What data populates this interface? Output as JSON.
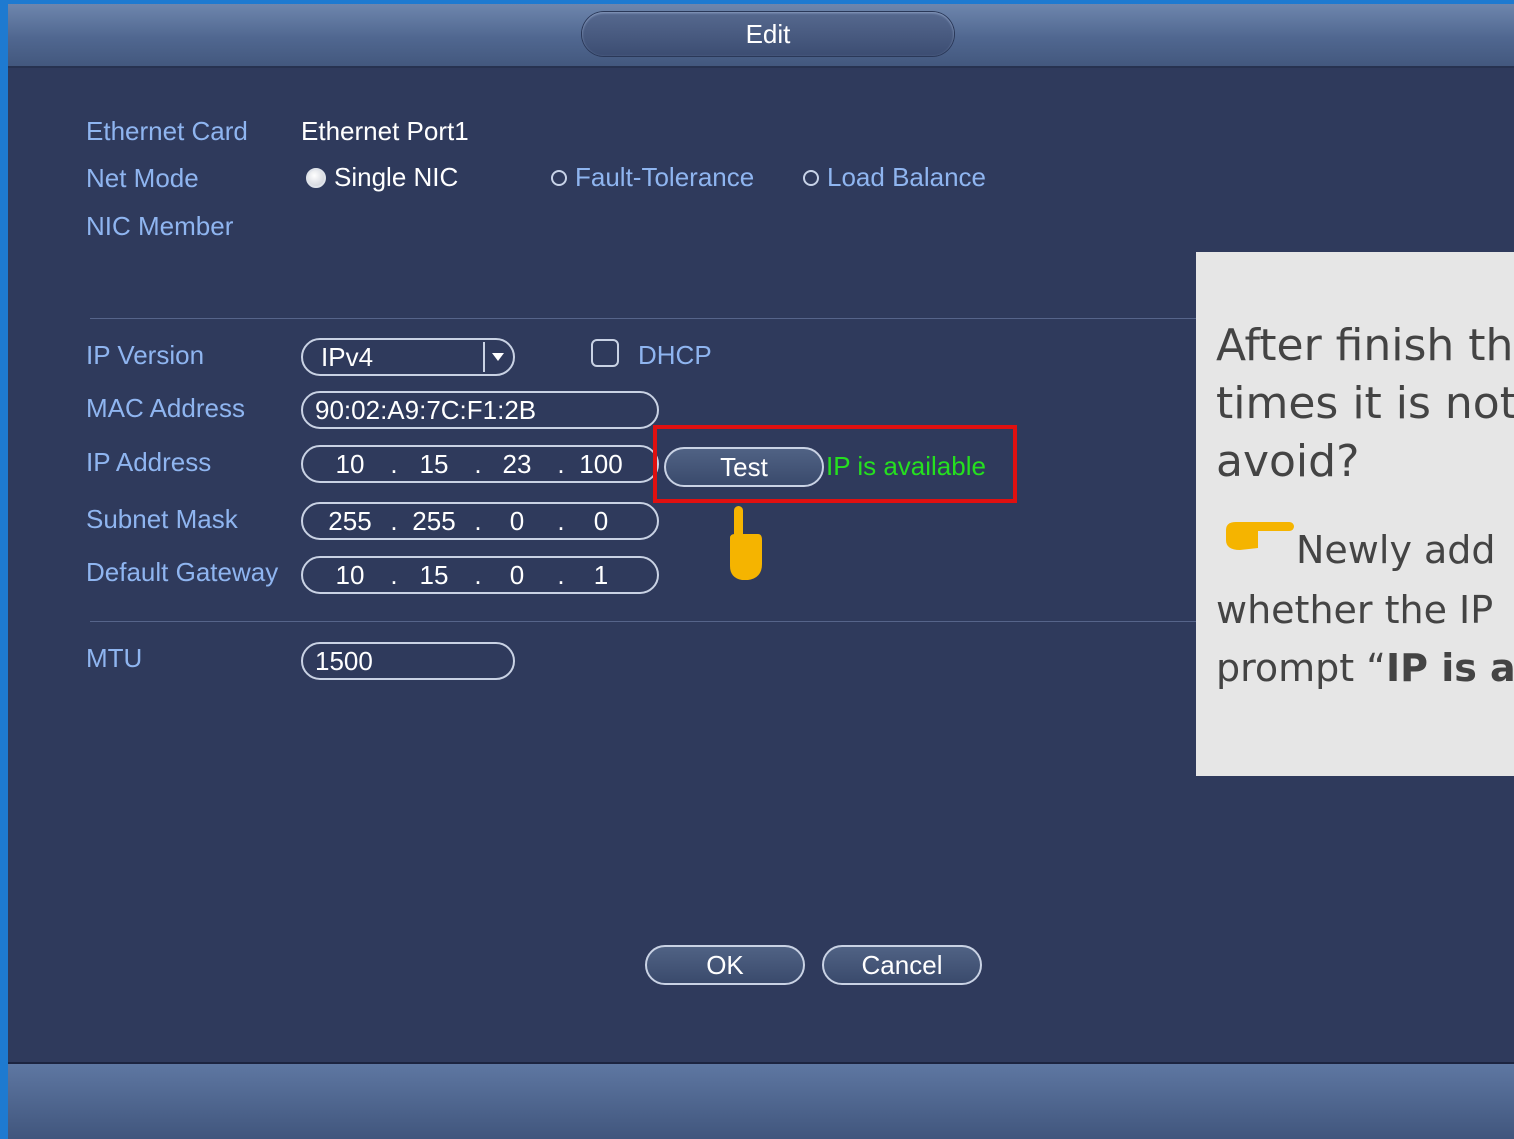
{
  "dialog": {
    "title": "Edit"
  },
  "ethernet_card": {
    "label": "Ethernet Card",
    "value": "Ethernet Port1"
  },
  "net_mode": {
    "label": "Net Mode",
    "options": [
      {
        "label": "Single NIC",
        "selected": true
      },
      {
        "label": "Fault-Tolerance",
        "selected": false
      },
      {
        "label": "Load Balance",
        "selected": false
      }
    ]
  },
  "nic_member": {
    "label": "NIC Member"
  },
  "ip_version": {
    "label": "IP Version",
    "value": "IPv4"
  },
  "dhcp": {
    "label": "DHCP",
    "checked": false
  },
  "mac_address": {
    "label": "MAC Address",
    "value": "90:02:A9:7C:F1:2B"
  },
  "ip_address": {
    "label": "IP Address",
    "octets": [
      "10",
      "15",
      "23",
      "100"
    ]
  },
  "subnet_mask": {
    "label": "Subnet Mask",
    "octets": [
      "255",
      "255",
      "0",
      "0"
    ]
  },
  "default_gateway": {
    "label": "Default Gateway",
    "octets": [
      "10",
      "15",
      "0",
      "1"
    ]
  },
  "mtu": {
    "label": "MTU",
    "value": "1500"
  },
  "test_button": {
    "label": "Test",
    "status": "IP is available"
  },
  "buttons": {
    "ok": "OK",
    "cancel": "Cancel"
  },
  "callout": {
    "line1": "After finish th",
    "line2": "times it is not",
    "line3": "avoid?",
    "line4": "Newly add",
    "line5": "whether the IP",
    "line6_prefix": "prompt “",
    "line6_bold": "IP is a"
  },
  "colors": {
    "label": "#8fb5f0",
    "status_ok": "#25e01f",
    "highlight": "#e01010",
    "pointer": "#f5b400",
    "dialog_bg": "#2f3a5c"
  },
  "icons": {
    "pointer": "hand-pointer-icon",
    "callout_pointer": "hand-pointing-right-icon",
    "dropdown": "chevron-down-icon"
  }
}
